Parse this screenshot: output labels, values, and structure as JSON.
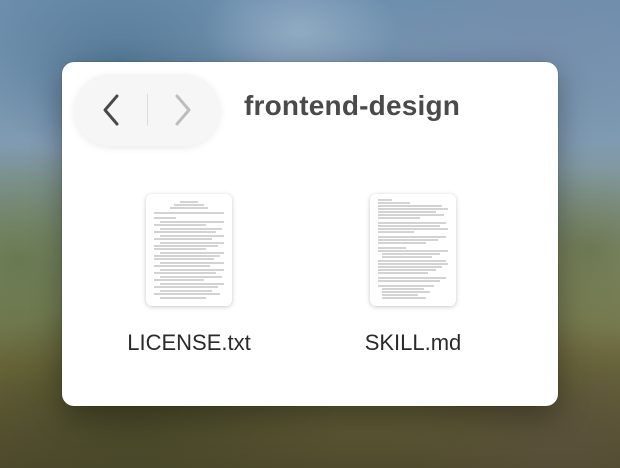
{
  "window": {
    "folder_title": "frontend-design"
  },
  "navigation": {
    "back_icon": "chevron-left-icon",
    "forward_icon": "chevron-right-icon"
  },
  "files": [
    {
      "name": "LICENSE.txt",
      "icon": "text-document-icon"
    },
    {
      "name": "SKILL.md",
      "icon": "text-document-icon"
    }
  ]
}
